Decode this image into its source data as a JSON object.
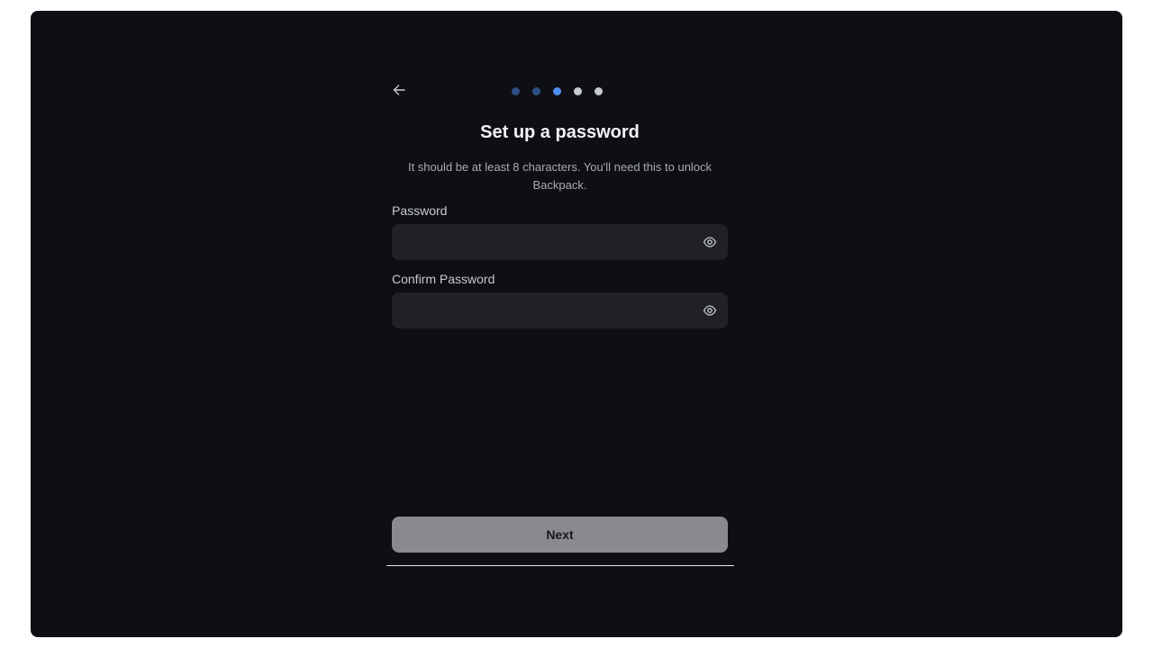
{
  "header": {
    "back_icon": "arrow-left-icon",
    "steps": [
      {
        "color": "#2e4f85"
      },
      {
        "color": "#2e4f85"
      },
      {
        "color": "#4e8ff2"
      },
      {
        "color": "#c8cad2"
      },
      {
        "color": "#c8cad2"
      }
    ]
  },
  "form": {
    "title": "Set up a password",
    "subtitle": "It should be at least 8 characters. You'll need this to unlock Backpack.",
    "password_label": "Password",
    "password_value": "",
    "confirm_label": "Confirm Password",
    "confirm_value": "",
    "toggle_icon": "eye-icon",
    "next_label": "Next"
  },
  "colors": {
    "background": "#0e0f14",
    "input_bg": "#202127",
    "button_bg": "#8a8a8e",
    "accent": "#4e8ff2"
  }
}
